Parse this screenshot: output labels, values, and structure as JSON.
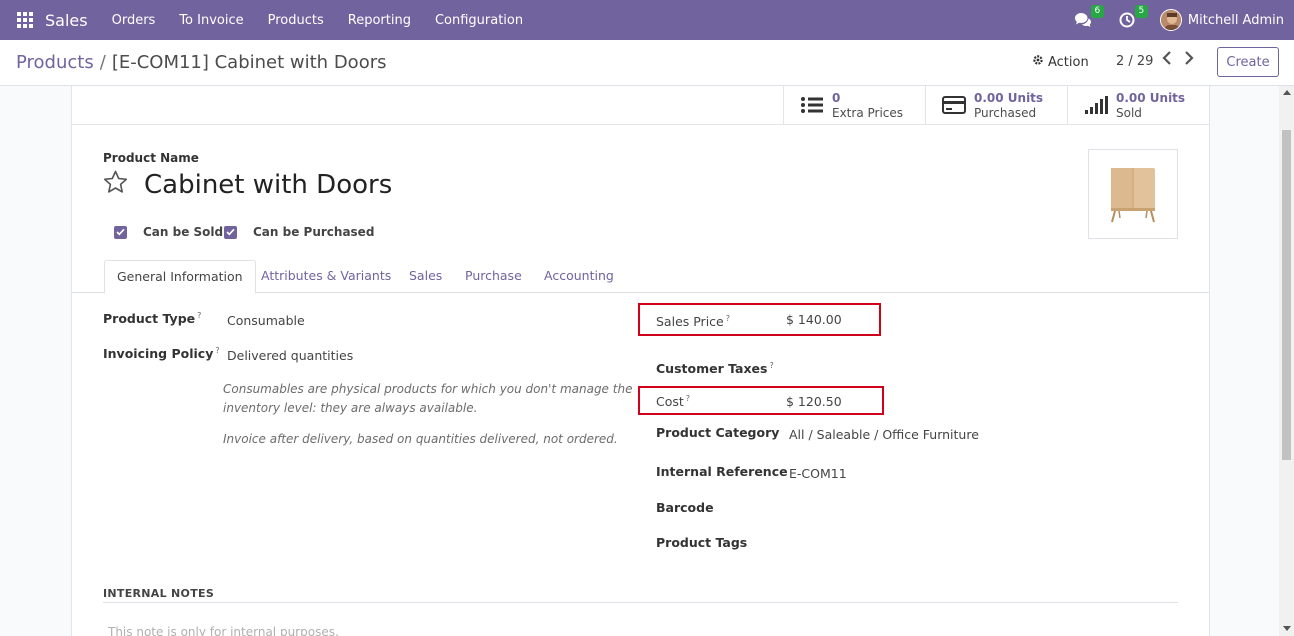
{
  "navbar": {
    "app_name": "Sales",
    "menu": [
      "Orders",
      "To Invoice",
      "Products",
      "Reporting",
      "Configuration"
    ],
    "chat_badge": "6",
    "activity_badge": "5",
    "user_name": "Mitchell Admin",
    "icons": [
      "apps-grid-icon",
      "chat-icon",
      "clock-icon"
    ]
  },
  "control_panel": {
    "breadcrumb_parent": "Products",
    "breadcrumb_separator": "/",
    "breadcrumb_current": "[E-COM11] Cabinet with Doors",
    "action_label": "Action",
    "pager": "2 / 29",
    "create_label": "Create"
  },
  "smart_buttons": [
    {
      "value": "0",
      "label": "Extra Prices",
      "icon": "list-icon"
    },
    {
      "value": "0.00 Units",
      "label": "Purchased",
      "icon": "credit-card-icon"
    },
    {
      "value": "0.00 Units",
      "label": "Sold",
      "icon": "signal-bars-icon"
    }
  ],
  "product": {
    "name_label": "Product Name",
    "name": "Cabinet with Doors",
    "can_be_sold_label": "Can be Sold",
    "can_be_sold": true,
    "can_be_purchased_label": "Can be Purchased",
    "can_be_purchased": true
  },
  "tabs": [
    "General Information",
    "Attributes & Variants",
    "Sales",
    "Purchase",
    "Accounting"
  ],
  "left_fields": {
    "product_type_label": "Product Type",
    "product_type": "Consumable",
    "invoicing_policy_label": "Invoicing Policy",
    "invoicing_policy": "Delivered quantities",
    "note1_line1": "Consumables are physical products for which you don't manage the",
    "note1_line2": "inventory level: they are always available.",
    "note2": "Invoice after delivery, based on quantities delivered, not ordered."
  },
  "right_fields": {
    "sales_price_label": "Sales Price",
    "sales_price": "$ 140.00",
    "customer_taxes_label": "Customer Taxes",
    "cost_label": "Cost",
    "cost": "$ 120.50",
    "product_category_label": "Product Category",
    "product_category": "All / Saleable / Office Furniture",
    "internal_reference_label": "Internal Reference",
    "internal_reference": "E-COM11",
    "barcode_label": "Barcode",
    "product_tags_label": "Product Tags",
    "help_mark": "?"
  },
  "notes": {
    "header": "INTERNAL NOTES",
    "placeholder": "This note is only for internal purposes."
  },
  "colors": {
    "brand": "#71639e",
    "highlight": "#d0021b",
    "badge": "#28a745"
  }
}
